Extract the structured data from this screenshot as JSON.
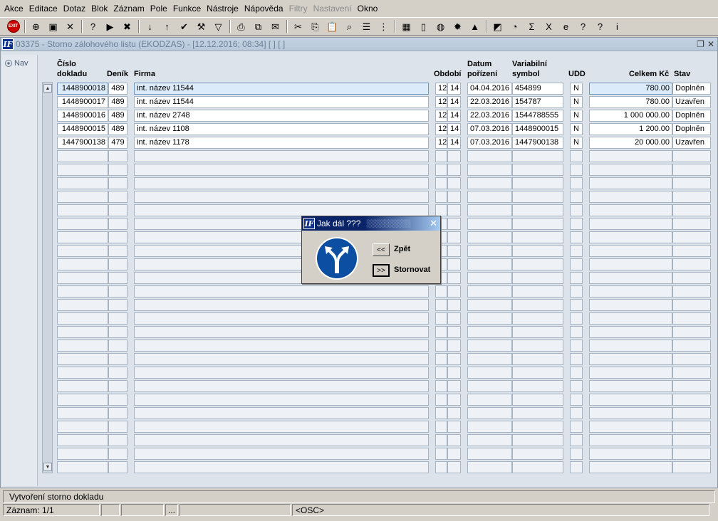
{
  "menu": [
    {
      "label": "Akce",
      "disabled": false
    },
    {
      "label": "Editace",
      "disabled": false
    },
    {
      "label": "Dotaz",
      "disabled": false
    },
    {
      "label": "Blok",
      "disabled": false
    },
    {
      "label": "Záznam",
      "disabled": false
    },
    {
      "label": "Pole",
      "disabled": false
    },
    {
      "label": "Funkce",
      "disabled": false
    },
    {
      "label": "Nástroje",
      "disabled": false
    },
    {
      "label": "Nápověda",
      "disabled": false
    },
    {
      "label": "Filtry",
      "disabled": true
    },
    {
      "label": "Nastavení",
      "disabled": true
    },
    {
      "label": "Okno",
      "disabled": false
    }
  ],
  "toolbar": {
    "exit_label": "EXIT",
    "icons": [
      "insert-record-icon",
      "save-record-icon",
      "delete-record-icon",
      "sep",
      "enter-query-icon",
      "execute-query-icon",
      "cancel-query-icon",
      "sep",
      "sort-asc-icon",
      "sort-desc-icon",
      "check-icon",
      "wrench-icon",
      "filter-icon",
      "sep",
      "print-icon",
      "print-preview-icon",
      "mail-icon",
      "sep",
      "cut-icon",
      "copy-icon",
      "paste-icon",
      "find-icon",
      "list-icon",
      "tree-icon",
      "sep",
      "calculator-icon",
      "document-icon",
      "globe-icon",
      "settings-icon",
      "terrain-icon",
      "sep",
      "chart-icon",
      "clock-icon",
      "sum-icon",
      "excel-icon",
      "web-icon",
      "help-book-icon",
      "help-icon",
      "info-icon"
    ],
    "glyphs": {
      "insert-record-icon": "⊕",
      "save-record-icon": "▣",
      "delete-record-icon": "✕",
      "enter-query-icon": "?",
      "execute-query-icon": "▶",
      "cancel-query-icon": "✖",
      "sort-asc-icon": "↓",
      "sort-desc-icon": "↑",
      "check-icon": "✔",
      "wrench-icon": "⚒",
      "filter-icon": "▽",
      "print-icon": "⎙",
      "print-preview-icon": "⧉",
      "mail-icon": "✉",
      "cut-icon": "✂",
      "copy-icon": "⎘",
      "paste-icon": "📋",
      "find-icon": "⌕",
      "list-icon": "☰",
      "tree-icon": "⋮",
      "calculator-icon": "▦",
      "document-icon": "▯",
      "globe-icon": "◍",
      "settings-icon": "✹",
      "terrain-icon": "▲",
      "chart-icon": "◩",
      "clock-icon": "◔",
      "sum-icon": "Σ",
      "excel-icon": "X",
      "web-icon": "e",
      "help-book-icon": "?",
      "help-icon": "?",
      "info-icon": "i"
    }
  },
  "window": {
    "title": "03375 - Storno zálohového listu (EKODZAS) - [12.12.2016; 08:34]  [ ]  [ ]",
    "logo": "IF",
    "nav_label": "Nav"
  },
  "columns": {
    "doc_line1": "Číslo",
    "doc_line2": "dokladu",
    "journal": "Deník",
    "firm": "Firma",
    "period": "Období",
    "date_line1": "Datum",
    "date_line2": "pořízení",
    "vs_line1": "Variabilní",
    "vs_line2": "symbol",
    "udd": "UDD",
    "total": "Celkem Kč",
    "state": "Stav"
  },
  "rows": [
    {
      "doc": "1448900018",
      "journal": "489",
      "firm": "int. název 11544",
      "p1": "12",
      "p2": "14",
      "date": "04.04.2016",
      "vs": "454899",
      "udd": "N",
      "total": "780.00",
      "state": "Doplněn"
    },
    {
      "doc": "1448900017",
      "journal": "489",
      "firm": "int. název 11544",
      "p1": "12",
      "p2": "14",
      "date": "22.03.2016",
      "vs": "154787",
      "udd": "N",
      "total": "780.00",
      "state": "Uzavřen"
    },
    {
      "doc": "1448900016",
      "journal": "489",
      "firm": "int. název 2748",
      "p1": "12",
      "p2": "14",
      "date": "22.03.2016",
      "vs": "1544788555",
      "udd": "N",
      "total": "1 000 000.00",
      "state": "Doplněn"
    },
    {
      "doc": "1448900015",
      "journal": "489",
      "firm": "int. název 1108",
      "p1": "12",
      "p2": "14",
      "date": "07.03.2016",
      "vs": "1448900015",
      "udd": "N",
      "total": "1 200.00",
      "state": "Doplněn"
    },
    {
      "doc": "1447900138",
      "journal": "479",
      "firm": "int. název 1178",
      "p1": "12",
      "p2": "14",
      "date": "07.03.2016",
      "vs": "1447900138",
      "udd": "N",
      "total": "20 000.00",
      "state": "Uzavřen"
    }
  ],
  "dialog": {
    "title": "Jak dál ???",
    "logo": "IF",
    "back_symbol": "<<",
    "back_label": "Zpět",
    "cancel_symbol": ">>",
    "cancel_label": "Stornovat",
    "sign_icon": "direction-split-icon",
    "sign_color": "#0b4ea2"
  },
  "status": {
    "message": "Vytvoření storno dokladu",
    "record": "Záznam: 1/1",
    "ellipsis": "...",
    "mode": "<OSC>"
  }
}
